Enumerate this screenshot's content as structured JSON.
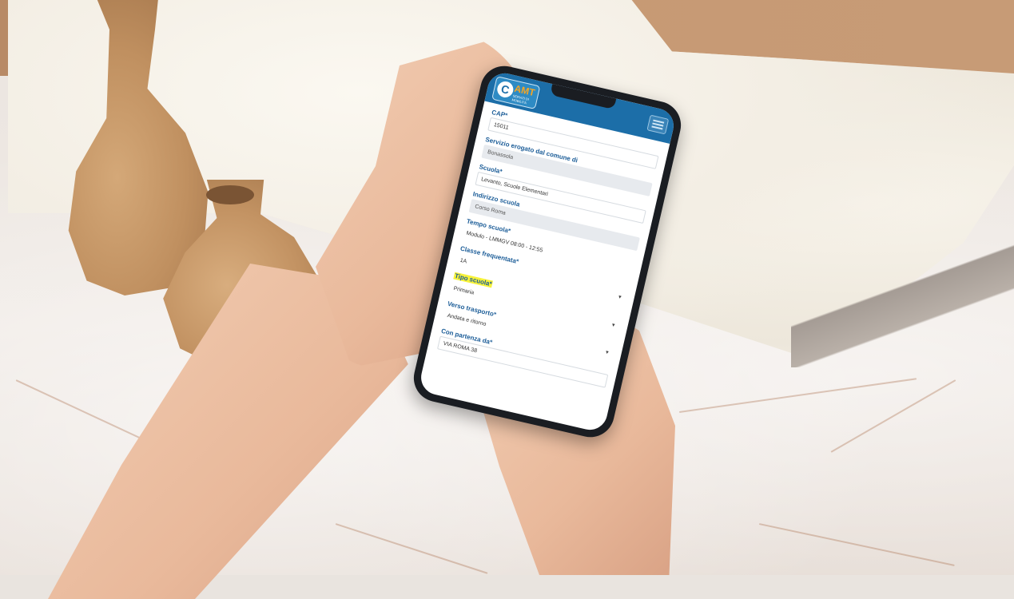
{
  "app": {
    "logo_text": "AMT",
    "logo_sub": "SERVIZI DI MOBILITÀ"
  },
  "form": {
    "fields": [
      {
        "label": "CAP*",
        "value": "15011"
      },
      {
        "label": "Servizio erogato dal comune di",
        "value": "Bonassola"
      },
      {
        "label": "Scuola*",
        "value": "Levanto, Scuole Elementari"
      },
      {
        "label": "Indirizzo scuola",
        "value": "Corso Roma"
      },
      {
        "label": "Tempo scuola*",
        "value": "Modulo - LMMGV 08:00 - 12:55"
      },
      {
        "label": "Classe frequentata*",
        "value": "1A"
      },
      {
        "label": "Tipo scuola*",
        "value": "Primaria"
      },
      {
        "label": "Verso trasporto*",
        "value": "Andata e ritorno"
      },
      {
        "label": "Con partenza da*",
        "value": "VIA ROMA 38"
      }
    ]
  },
  "colors": {
    "header": "#1c6ea8",
    "label": "#1c5d98",
    "highlight": "#f7f23a",
    "logo_accent": "#f5a623"
  },
  "icons": {
    "menu": "hamburger-menu-icon",
    "dropdown": "chevron-down-icon"
  }
}
